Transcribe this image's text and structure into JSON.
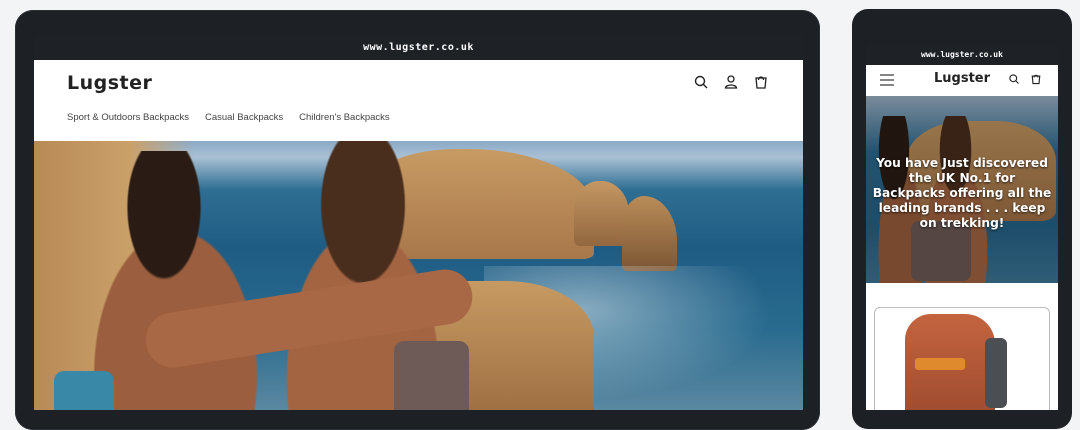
{
  "laptop": {
    "url": "www.lugster.co.uk",
    "brand": "Lugster",
    "nav": [
      {
        "label": "Sport & Outdoors Backpacks"
      },
      {
        "label": "Casual Backpacks"
      },
      {
        "label": "Children's Backpacks"
      }
    ],
    "icons": [
      "search-icon",
      "account-icon",
      "cart-icon"
    ],
    "hero_caption": ""
  },
  "phone": {
    "url": "www.lugster.co.uk",
    "brand": "Lugster",
    "icons": [
      "menu-icon",
      "search-icon",
      "cart-icon"
    ],
    "hero_text": "You have Just discovered the UK No.1 for Backpacks offering all the leading brands . . . keep on trekking!"
  },
  "colors": {
    "device_frame": "#1d2125",
    "page_bg": "#f3f4f6",
    "brand_text": "#222222"
  }
}
